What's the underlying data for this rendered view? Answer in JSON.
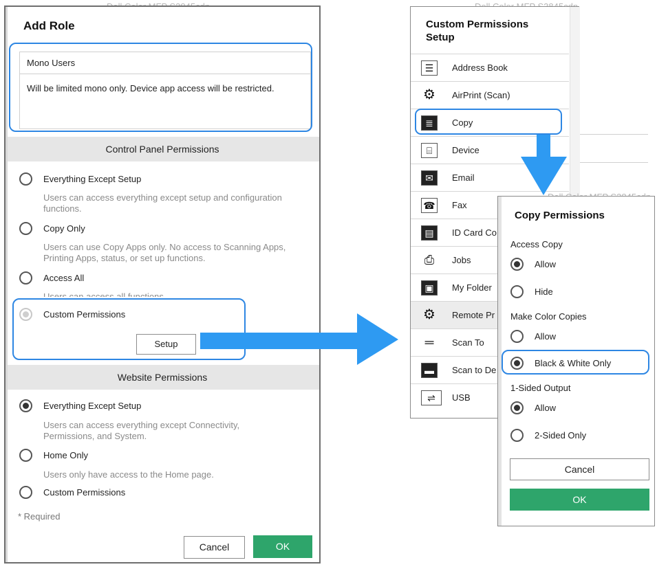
{
  "background_text": {
    "top_left": "Dell Color MFP S3845cdn",
    "top_right": "Dell Color MFP S3845cdn",
    "mid_right": "Dell Color MFP S3845cdn",
    "side_fragment": "e r"
  },
  "add_role": {
    "title": "Add Role",
    "name_value": "Mono Users",
    "description_value": "Will be limited mono only. Device app access will be restricted.",
    "control_panel_header": "Control Panel Permissions",
    "control_options": [
      {
        "label": "Everything Except Setup",
        "help": "Users can access everything except setup and configuration functions."
      },
      {
        "label": "Copy Only",
        "help": "Users can use Copy Apps only. No access to Scanning Apps, Printing Apps, status, or set up functions."
      },
      {
        "label": "Access All",
        "help": "Users can access all functions."
      },
      {
        "label": "Custom Permissions",
        "help": ""
      }
    ],
    "setup_button": "Setup",
    "website_header": "Website Permissions",
    "website_options": [
      {
        "label": "Everything Except Setup",
        "help": "Users can access everything except Connectivity, Permissions, and System."
      },
      {
        "label": "Home Only",
        "help": "Users only have access to the Home page."
      },
      {
        "label": "Custom Permissions",
        "help": ""
      }
    ],
    "required_note": "* Required",
    "cancel_button": "Cancel",
    "ok_button": "OK"
  },
  "custom_setup": {
    "title_line1": "Custom Permissions",
    "title_line2": "Setup",
    "items": [
      {
        "label": "Address Book",
        "icon": "address-book-icon",
        "glyph": "☰"
      },
      {
        "label": "AirPrint (Scan)",
        "icon": "gear-icon",
        "glyph": "⚙"
      },
      {
        "label": "Copy",
        "icon": "copy-icon",
        "glyph": "≣"
      },
      {
        "label": "Device",
        "icon": "device-icon",
        "glyph": "⌸"
      },
      {
        "label": "Email",
        "icon": "email-icon",
        "glyph": "✉"
      },
      {
        "label": "Fax",
        "icon": "fax-icon",
        "glyph": "☎"
      },
      {
        "label": "ID Card Co",
        "icon": "id-card-icon",
        "glyph": "▤"
      },
      {
        "label": "Jobs",
        "icon": "jobs-icon",
        "glyph": "⎙"
      },
      {
        "label": "My Folder",
        "icon": "folder-icon",
        "glyph": "▣"
      },
      {
        "label": "Remote Pr",
        "icon": "gear-icon",
        "glyph": "⚙"
      },
      {
        "label": "Scan To",
        "icon": "scanner-icon",
        "glyph": "═"
      },
      {
        "label": "Scan to De",
        "icon": "computer-icon",
        "glyph": "▬"
      },
      {
        "label": "USB",
        "icon": "usb-icon",
        "glyph": "⇌"
      }
    ]
  },
  "copy_permissions": {
    "title": "Copy Permissions",
    "groups": [
      {
        "label": "Access Copy",
        "options": [
          {
            "label": "Allow",
            "selected": true
          },
          {
            "label": "Hide",
            "selected": false
          }
        ]
      },
      {
        "label": "Make Color Copies",
        "options": [
          {
            "label": "Allow",
            "selected": false
          },
          {
            "label": "Black & White Only",
            "selected": true
          }
        ]
      },
      {
        "label": "1-Sided Output",
        "options": [
          {
            "label": "Allow",
            "selected": true
          },
          {
            "label": "2-Sided Only",
            "selected": false
          }
        ]
      }
    ],
    "cancel_button": "Cancel",
    "ok_button": "OK"
  },
  "colors": {
    "highlight": "#2d86e3",
    "arrow": "#2e9af2",
    "ok_green": "#2ea56b",
    "section_bar": "#e6e6e6"
  }
}
